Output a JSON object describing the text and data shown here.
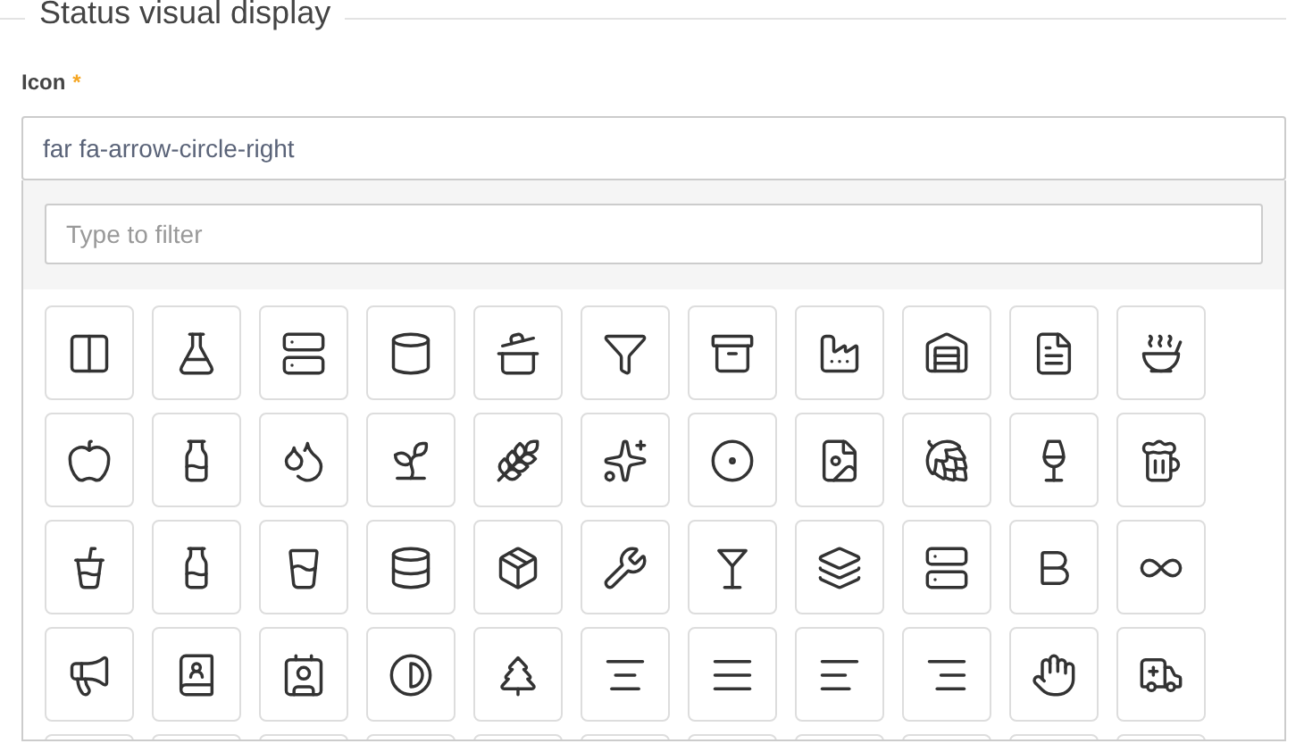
{
  "section": {
    "legend": "Status visual display"
  },
  "field": {
    "label": "Icon",
    "required_mark": "*",
    "value": "far fa-arrow-circle-right"
  },
  "dropdown": {
    "filter": {
      "placeholder": "Type to filter"
    },
    "icons": [
      {
        "kind": "columns"
      },
      {
        "kind": "flask"
      },
      {
        "kind": "server"
      },
      {
        "kind": "cylinder"
      },
      {
        "kind": "pot"
      },
      {
        "kind": "funnel"
      },
      {
        "kind": "archive"
      },
      {
        "kind": "factory"
      },
      {
        "kind": "warehouse"
      },
      {
        "kind": "document"
      },
      {
        "kind": "bowl"
      },
      {
        "kind": "apple"
      },
      {
        "kind": "jar"
      },
      {
        "kind": "droplets"
      },
      {
        "kind": "sprout"
      },
      {
        "kind": "wheat"
      },
      {
        "kind": "sparkles"
      },
      {
        "kind": "bubbles"
      },
      {
        "kind": "image-file"
      },
      {
        "kind": "hop"
      },
      {
        "kind": "wine"
      },
      {
        "kind": "beer"
      },
      {
        "kind": "can"
      },
      {
        "kind": "bottle"
      },
      {
        "kind": "glass"
      },
      {
        "kind": "tank"
      },
      {
        "kind": "package"
      },
      {
        "kind": "opener"
      },
      {
        "kind": "martini"
      },
      {
        "kind": "barrel"
      },
      {
        "kind": "keg"
      },
      {
        "kind": "bold"
      },
      {
        "kind": "infinity"
      },
      {
        "kind": "ad"
      },
      {
        "kind": "address-book"
      },
      {
        "kind": "address-card"
      },
      {
        "kind": "contrast"
      },
      {
        "kind": "tree"
      },
      {
        "kind": "align-center"
      },
      {
        "kind": "align-justify"
      },
      {
        "kind": "align-left"
      },
      {
        "kind": "align-right"
      },
      {
        "kind": "hand"
      },
      {
        "kind": "ambulance"
      },
      {
        "kind": "blank"
      },
      {
        "kind": "blank"
      },
      {
        "kind": "blank"
      },
      {
        "kind": "blank"
      },
      {
        "kind": "blank"
      },
      {
        "kind": "blank"
      },
      {
        "kind": "blank"
      },
      {
        "kind": "blank"
      },
      {
        "kind": "blank"
      },
      {
        "kind": "blank"
      },
      {
        "kind": "blank"
      }
    ]
  }
}
